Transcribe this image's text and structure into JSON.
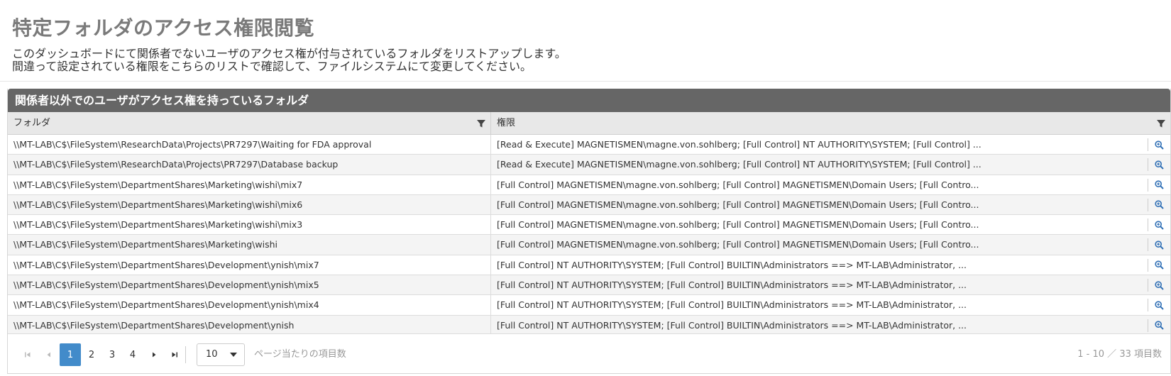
{
  "page": {
    "title": "特定フォルダのアクセス権限閲覧",
    "description_line1": "このダッシュボードにて関係者でないユーザのアクセス権が付与されているフォルダをリストアップします。",
    "description_line2": "間違って設定されている権限をこちらのリストで確認して、ファイルシステムにて変更してください。"
  },
  "panel": {
    "title": "関係者以外でのユーザがアクセス権を持っているフォルダ"
  },
  "grid": {
    "columns": [
      "フォルダ",
      "権限"
    ],
    "rows": [
      [
        "\\\\MT-LAB\\C$\\FileSystem\\ResearchData\\Projects\\PR7297\\Waiting for FDA approval",
        "[Read & Execute] MAGNETISMEN\\magne.von.sohlberg; [Full Control] NT AUTHORITY\\SYSTEM; [Full Control] ..."
      ],
      [
        "\\\\MT-LAB\\C$\\FileSystem\\ResearchData\\Projects\\PR7297\\Database backup",
        "[Read & Execute] MAGNETISMEN\\magne.von.sohlberg; [Full Control] NT AUTHORITY\\SYSTEM; [Full Control] ..."
      ],
      [
        "\\\\MT-LAB\\C$\\FileSystem\\DepartmentShares\\Marketing\\wishi\\mix7",
        "[Full Control] MAGNETISMEN\\magne.von.sohlberg; [Full Control] MAGNETISMEN\\Domain Users; [Full Contro..."
      ],
      [
        "\\\\MT-LAB\\C$\\FileSystem\\DepartmentShares\\Marketing\\wishi\\mix6",
        "[Full Control] MAGNETISMEN\\magne.von.sohlberg; [Full Control] MAGNETISMEN\\Domain Users; [Full Contro..."
      ],
      [
        "\\\\MT-LAB\\C$\\FileSystem\\DepartmentShares\\Marketing\\wishi\\mix3",
        "[Full Control] MAGNETISMEN\\magne.von.sohlberg; [Full Control] MAGNETISMEN\\Domain Users; [Full Contro..."
      ],
      [
        "\\\\MT-LAB\\C$\\FileSystem\\DepartmentShares\\Marketing\\wishi",
        "[Full Control] MAGNETISMEN\\magne.von.sohlberg; [Full Control] MAGNETISMEN\\Domain Users; [Full Contro..."
      ],
      [
        "\\\\MT-LAB\\C$\\FileSystem\\DepartmentShares\\Development\\ynish\\mix7",
        "[Full Control] NT AUTHORITY\\SYSTEM; [Full Control] BUILTIN\\Administrators ==> MT-LAB\\Administrator, ..."
      ],
      [
        "\\\\MT-LAB\\C$\\FileSystem\\DepartmentShares\\Development\\ynish\\mix5",
        "[Full Control] NT AUTHORITY\\SYSTEM; [Full Control] BUILTIN\\Administrators ==> MT-LAB\\Administrator, ..."
      ],
      [
        "\\\\MT-LAB\\C$\\FileSystem\\DepartmentShares\\Development\\ynish\\mix4",
        "[Full Control] NT AUTHORITY\\SYSTEM; [Full Control] BUILTIN\\Administrators ==> MT-LAB\\Administrator, ..."
      ],
      [
        "\\\\MT-LAB\\C$\\FileSystem\\DepartmentShares\\Development\\ynish",
        "[Full Control] NT AUTHORITY\\SYSTEM; [Full Control] BUILTIN\\Administrators ==> MT-LAB\\Administrator, ..."
      ]
    ]
  },
  "pager": {
    "pages": [
      "1",
      "2",
      "3",
      "4"
    ],
    "current_page": "1",
    "page_size": "10",
    "page_size_label": "ページ当たりの項目数",
    "info": "1 - 10 ／ 33 項目数"
  },
  "colors": {
    "header_bg": "#666666",
    "accent": "#428bca",
    "title": "#7a7a7a"
  }
}
